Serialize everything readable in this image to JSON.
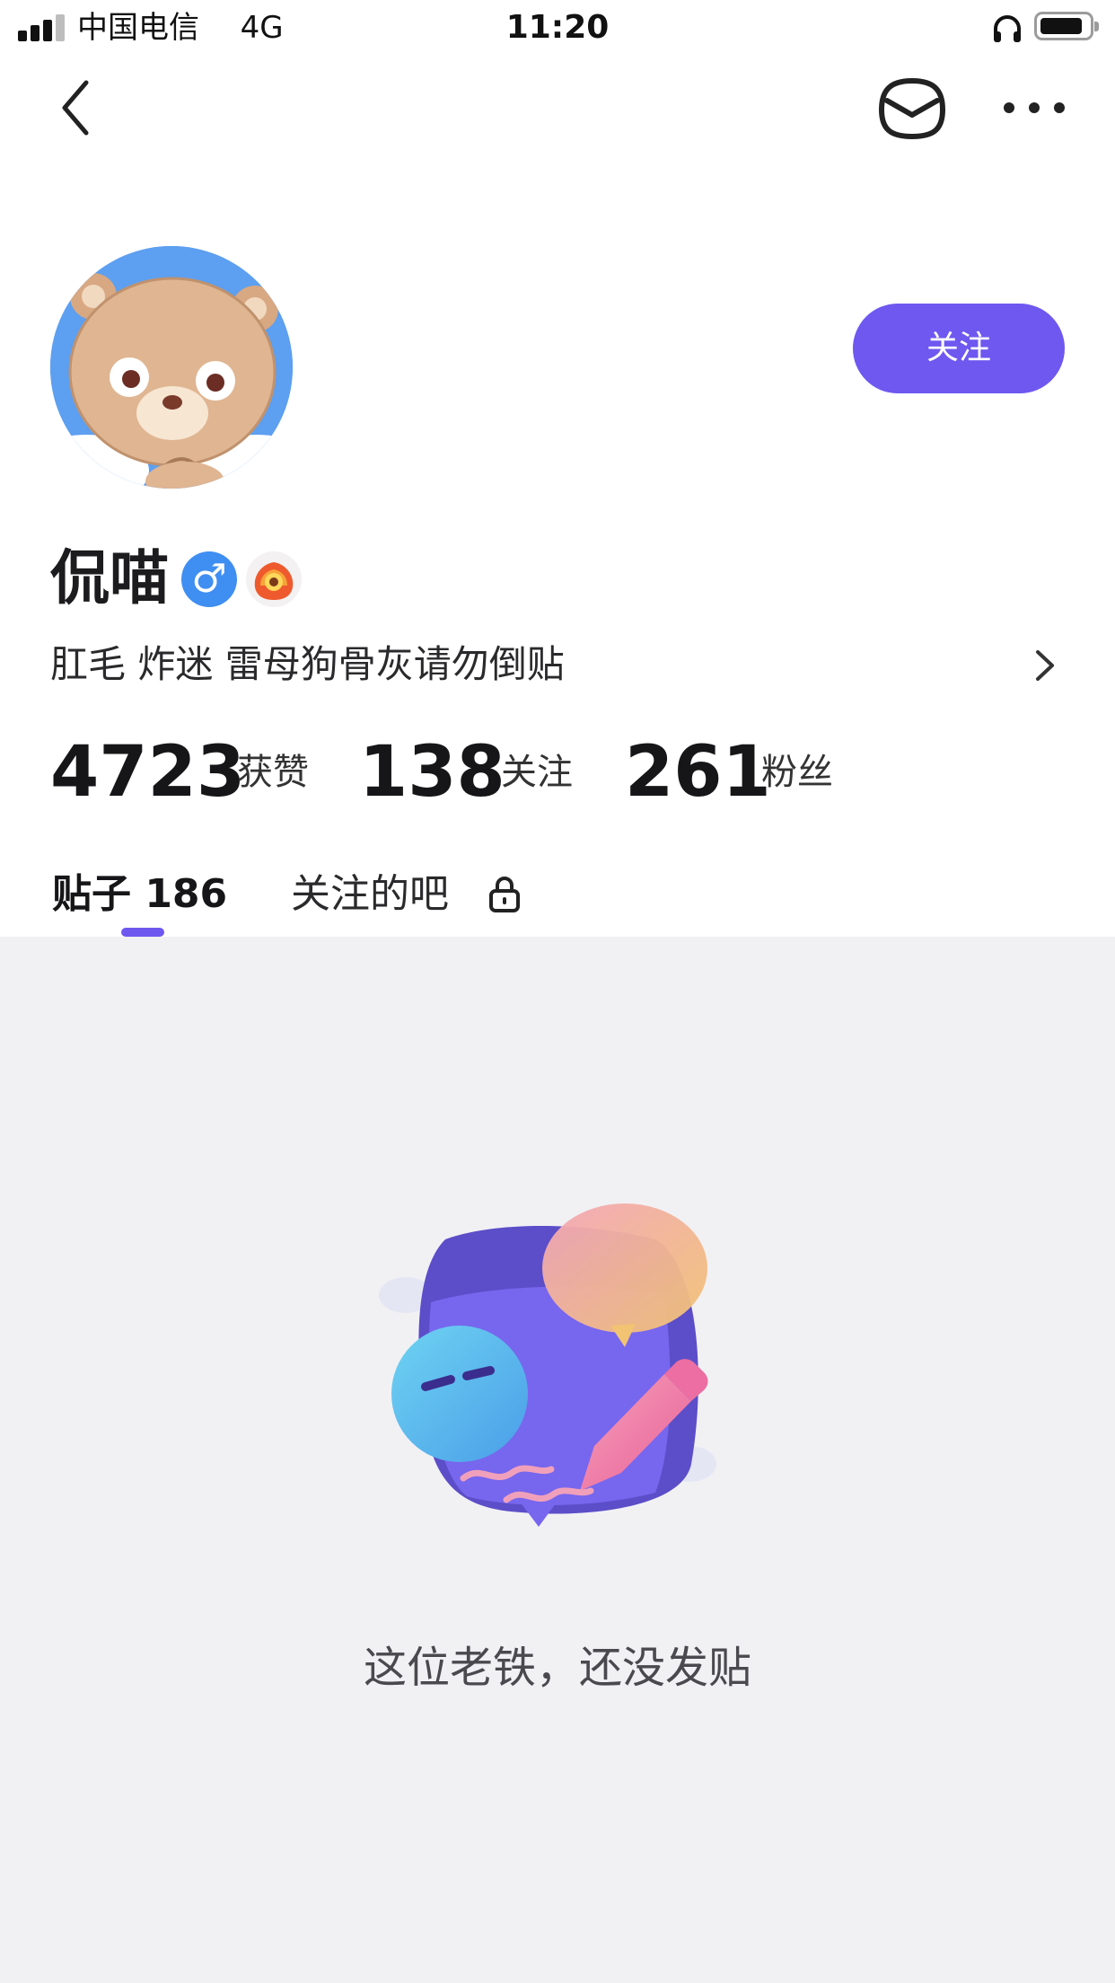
{
  "status_bar": {
    "carrier": "中国电信",
    "network": "4G",
    "time": "11:20"
  },
  "profile": {
    "username": "侃喵",
    "gender_symbol": "♂",
    "bio": "肛毛 炸迷 雷母狗骨灰请勿倒贴",
    "follow_label": "关注"
  },
  "stats": {
    "likes": {
      "value": "4723",
      "label": "获赞"
    },
    "following": {
      "value": "138",
      "label": "关注"
    },
    "followers": {
      "value": "261",
      "label": "粉丝"
    }
  },
  "tabs": {
    "posts": "贴子 186",
    "followed_bars": "关注的吧"
  },
  "empty_state": {
    "message": "这位老铁，还没发贴"
  },
  "colors": {
    "accent": "#6e58f0",
    "background": "#f1f1f4",
    "gender_badge": "#3f8ef2"
  },
  "icons": [
    "back-icon",
    "mail-icon",
    "more-icon",
    "lock-icon",
    "chevron-right-icon",
    "headphone-icon"
  ]
}
